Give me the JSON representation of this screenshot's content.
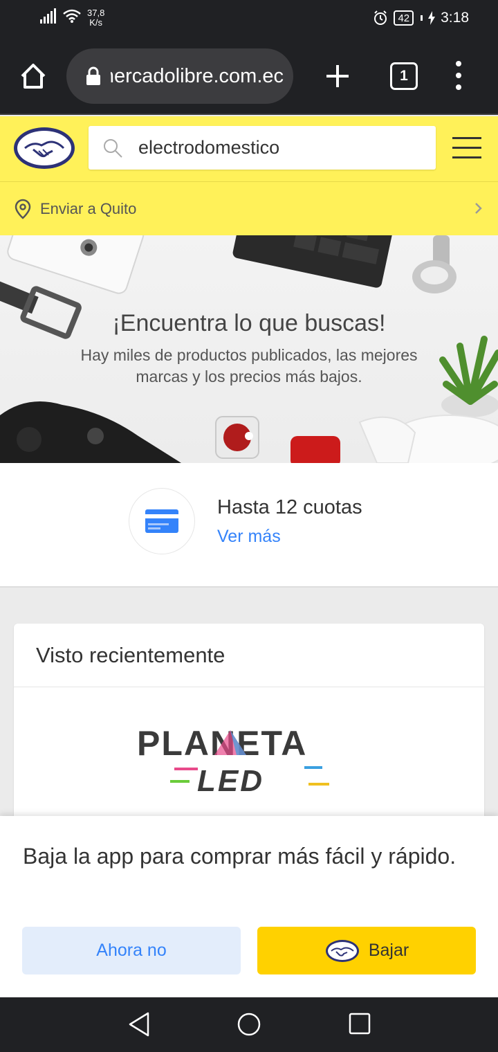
{
  "status_bar": {
    "net_speed_value": "37,8",
    "net_speed_unit": "K/s",
    "battery": "42",
    "time": "3:18"
  },
  "browser": {
    "url": "mercadolibre.com.ec",
    "tab_count": "1"
  },
  "header": {
    "search_value": "electrodomestico",
    "deliver_label": "Enviar a Quito"
  },
  "banner": {
    "title": "¡Encuentra lo que buscas!",
    "subtitle": "Hay miles de productos publicados, las mejores marcas y los precios más bajos."
  },
  "cuotas": {
    "title": "Hasta 12 cuotas",
    "link": "Ver más"
  },
  "recent": {
    "title": "Visto recientemente",
    "logo_word1": "PLANETA",
    "logo_word2": "LED"
  },
  "app_banner": {
    "text": "Baja la app para comprar más fácil y rápido.",
    "no_label": "Ahora no",
    "yes_label": "Bajar"
  },
  "colors": {
    "brand_yellow": "#fff159",
    "accent_blue": "#3483fa",
    "button_yellow": "#ffd100",
    "chrome_dark": "#202124"
  },
  "icons": [
    "signal-icon",
    "wifi-icon",
    "alarm-icon",
    "battery-icon",
    "home-icon",
    "lock-icon",
    "plus-icon",
    "tabs-icon",
    "more-vert-icon",
    "ml-handshake-logo",
    "search-icon",
    "hamburger-icon",
    "location-pin-icon",
    "chevron-right-icon",
    "credit-card-icon",
    "nav-back-icon",
    "nav-home-icon",
    "nav-recent-icon"
  ]
}
